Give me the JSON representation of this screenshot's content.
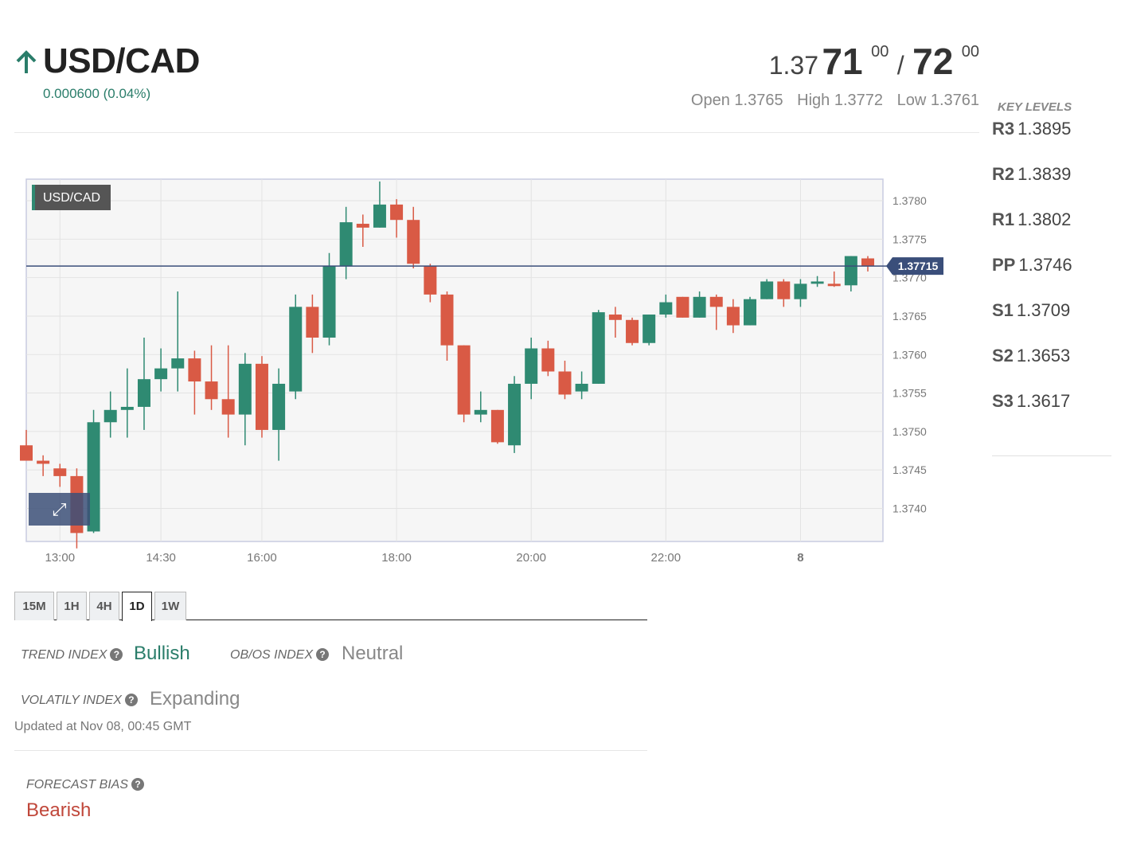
{
  "header": {
    "symbol": "USD/CAD",
    "change": "0.000600 (0.04%)",
    "direction_icon": "arrow-up-icon"
  },
  "quote": {
    "bid_prefix": "1.37",
    "bid_main": "71",
    "bid_sup": "00",
    "separator": "/",
    "ask_main": "72",
    "ask_sup": "00",
    "open": "Open 1.3765",
    "high": "High 1.3772",
    "low": "Low 1.3761"
  },
  "key_levels": {
    "title": "KEY LEVELS",
    "items": [
      {
        "label": "R3",
        "value": "1.3895"
      },
      {
        "label": "R2",
        "value": "1.3839"
      },
      {
        "label": "R1",
        "value": "1.3802"
      },
      {
        "label": "PP",
        "value": "1.3746"
      },
      {
        "label": "S1",
        "value": "1.3709"
      },
      {
        "label": "S2",
        "value": "1.3653"
      },
      {
        "label": "S3",
        "value": "1.3617"
      }
    ]
  },
  "chart_data": {
    "type": "candlestick",
    "symbol_label": "USD/CAD",
    "last_price": 1.37715,
    "last_price_label": "1.37715",
    "ylim": [
      1.37357,
      1.37828
    ],
    "y_ticks": [
      1.374,
      1.3745,
      1.375,
      1.3755,
      1.376,
      1.3765,
      1.377,
      1.3775,
      1.378
    ],
    "y_tick_labels": [
      "1.3740",
      "1.3745",
      "1.3750",
      "1.3755",
      "1.3760",
      "1.3765",
      "1.3770",
      "1.3775",
      "1.3780"
    ],
    "x_ticks": [
      {
        "t": 13.0,
        "label": "13:00"
      },
      {
        "t": 14.5,
        "label": "14:30"
      },
      {
        "t": 16.0,
        "label": "16:00"
      },
      {
        "t": 18.0,
        "label": "18:00"
      },
      {
        "t": 20.0,
        "label": "20:00"
      },
      {
        "t": 22.0,
        "label": "22:00"
      },
      {
        "t": 24.0,
        "label": "8"
      }
    ],
    "grid": true,
    "bull_color": "#2f8a72",
    "bear_color": "#d95a45",
    "candles": [
      {
        "t": 12.5,
        "o": 1.37482,
        "h": 1.37502,
        "l": 1.37472,
        "c": 1.37462
      },
      {
        "t": 12.75,
        "o": 1.37462,
        "h": 1.37469,
        "l": 1.37442,
        "c": 1.37458
      },
      {
        "t": 13.0,
        "o": 1.37452,
        "h": 1.37458,
        "l": 1.37428,
        "c": 1.37442
      },
      {
        "t": 13.25,
        "o": 1.37442,
        "h": 1.37452,
        "l": 1.37348,
        "c": 1.37368
      },
      {
        "t": 13.5,
        "o": 1.3737,
        "h": 1.37528,
        "l": 1.37368,
        "c": 1.37512
      },
      {
        "t": 13.75,
        "o": 1.37512,
        "h": 1.37552,
        "l": 1.37492,
        "c": 1.37528
      },
      {
        "t": 14.0,
        "o": 1.37528,
        "h": 1.37582,
        "l": 1.37492,
        "c": 1.37532
      },
      {
        "t": 14.25,
        "o": 1.37532,
        "h": 1.37622,
        "l": 1.37502,
        "c": 1.37568
      },
      {
        "t": 14.5,
        "o": 1.37568,
        "h": 1.37608,
        "l": 1.37552,
        "c": 1.37582
      },
      {
        "t": 14.75,
        "o": 1.37582,
        "h": 1.37682,
        "l": 1.37552,
        "c": 1.37595
      },
      {
        "t": 15.0,
        "o": 1.37595,
        "h": 1.37605,
        "l": 1.37522,
        "c": 1.37565
      },
      {
        "t": 15.25,
        "o": 1.37565,
        "h": 1.37612,
        "l": 1.37528,
        "c": 1.37542
      },
      {
        "t": 15.5,
        "o": 1.37542,
        "h": 1.37612,
        "l": 1.37492,
        "c": 1.37522
      },
      {
        "t": 15.75,
        "o": 1.37522,
        "h": 1.37602,
        "l": 1.37482,
        "c": 1.37588
      },
      {
        "t": 16.0,
        "o": 1.37588,
        "h": 1.37598,
        "l": 1.37492,
        "c": 1.37502
      },
      {
        "t": 16.25,
        "o": 1.37502,
        "h": 1.37582,
        "l": 1.37462,
        "c": 1.37562
      },
      {
        "t": 16.5,
        "o": 1.37552,
        "h": 1.37678,
        "l": 1.37542,
        "c": 1.37662
      },
      {
        "t": 16.75,
        "o": 1.37662,
        "h": 1.37678,
        "l": 1.37602,
        "c": 1.37622
      },
      {
        "t": 17.0,
        "o": 1.37622,
        "h": 1.37732,
        "l": 1.37612,
        "c": 1.37715
      },
      {
        "t": 17.25,
        "o": 1.37715,
        "h": 1.37792,
        "l": 1.37698,
        "c": 1.37772
      },
      {
        "t": 17.5,
        "o": 1.3777,
        "h": 1.37782,
        "l": 1.3774,
        "c": 1.37765
      },
      {
        "t": 17.75,
        "o": 1.37765,
        "h": 1.37825,
        "l": 1.37765,
        "c": 1.37795
      },
      {
        "t": 18.0,
        "o": 1.37795,
        "h": 1.37802,
        "l": 1.37752,
        "c": 1.37775
      },
      {
        "t": 18.25,
        "o": 1.37775,
        "h": 1.37792,
        "l": 1.37712,
        "c": 1.37718
      },
      {
        "t": 18.5,
        "o": 1.37715,
        "h": 1.37718,
        "l": 1.37668,
        "c": 1.37678
      },
      {
        "t": 18.75,
        "o": 1.37678,
        "h": 1.37682,
        "l": 1.37592,
        "c": 1.37612
      },
      {
        "t": 19.0,
        "o": 1.37612,
        "h": 1.37612,
        "l": 1.37512,
        "c": 1.37522
      },
      {
        "t": 19.25,
        "o": 1.37522,
        "h": 1.37552,
        "l": 1.37512,
        "c": 1.37528
      },
      {
        "t": 19.5,
        "o": 1.37528,
        "h": 1.37528,
        "l": 1.37484,
        "c": 1.37486
      },
      {
        "t": 19.75,
        "o": 1.37482,
        "h": 1.37572,
        "l": 1.37472,
        "c": 1.37562
      },
      {
        "t": 20.0,
        "o": 1.37562,
        "h": 1.37622,
        "l": 1.37542,
        "c": 1.37608
      },
      {
        "t": 20.25,
        "o": 1.37608,
        "h": 1.37618,
        "l": 1.37572,
        "c": 1.37578
      },
      {
        "t": 20.5,
        "o": 1.37578,
        "h": 1.37592,
        "l": 1.37542,
        "c": 1.37548
      },
      {
        "t": 20.75,
        "o": 1.37552,
        "h": 1.37578,
        "l": 1.37542,
        "c": 1.37562
      },
      {
        "t": 21.0,
        "o": 1.37562,
        "h": 1.37658,
        "l": 1.37562,
        "c": 1.37655
      },
      {
        "t": 21.25,
        "o": 1.37652,
        "h": 1.37662,
        "l": 1.37622,
        "c": 1.37645
      },
      {
        "t": 21.5,
        "o": 1.37645,
        "h": 1.37648,
        "l": 1.37612,
        "c": 1.37615
      },
      {
        "t": 21.75,
        "o": 1.37615,
        "h": 1.37652,
        "l": 1.37612,
        "c": 1.37652
      },
      {
        "t": 22.0,
        "o": 1.37652,
        "h": 1.37678,
        "l": 1.37648,
        "c": 1.37668
      },
      {
        "t": 22.25,
        "o": 1.37675,
        "h": 1.37675,
        "l": 1.37648,
        "c": 1.37648
      },
      {
        "t": 22.5,
        "o": 1.37648,
        "h": 1.37682,
        "l": 1.37648,
        "c": 1.37675
      },
      {
        "t": 22.75,
        "o": 1.37675,
        "h": 1.37678,
        "l": 1.37632,
        "c": 1.37662
      },
      {
        "t": 23.0,
        "o": 1.37662,
        "h": 1.37672,
        "l": 1.37628,
        "c": 1.37638
      },
      {
        "t": 23.25,
        "o": 1.37638,
        "h": 1.37675,
        "l": 1.37638,
        "c": 1.37672
      },
      {
        "t": 23.5,
        "o": 1.37672,
        "h": 1.37698,
        "l": 1.37672,
        "c": 1.37695
      },
      {
        "t": 23.75,
        "o": 1.37695,
        "h": 1.37698,
        "l": 1.37662,
        "c": 1.37672
      },
      {
        "t": 24.0,
        "o": 1.37672,
        "h": 1.37698,
        "l": 1.37662,
        "c": 1.37692
      },
      {
        "t": 24.25,
        "o": 1.37692,
        "h": 1.37702,
        "l": 1.37688,
        "c": 1.37695
      },
      {
        "t": 24.5,
        "o": 1.37692,
        "h": 1.37708,
        "l": 1.37688,
        "c": 1.37689
      },
      {
        "t": 24.75,
        "o": 1.3769,
        "h": 1.37728,
        "l": 1.37682,
        "c": 1.37728
      },
      {
        "t": 25.0,
        "o": 1.37725,
        "h": 1.37728,
        "l": 1.37708,
        "c": 1.37715
      }
    ]
  },
  "timeframes": {
    "tabs": [
      "15M",
      "1H",
      "4H",
      "1D",
      "1W"
    ],
    "active": "1D"
  },
  "indices": {
    "trend_label": "TREND INDEX",
    "trend_value": "Bullish",
    "obos_label": "OB/OS INDEX",
    "obos_value": "Neutral",
    "volatility_label": "VOLATILY INDEX",
    "volatility_value": "Expanding",
    "help_icon": "question-circle-icon"
  },
  "updated": "Updated at Nov 08, 00:45 GMT",
  "forecast": {
    "label": "FORECAST BIAS",
    "value": "Bearish"
  },
  "colors": {
    "bullish": "#2a7d6a",
    "bearish": "#c0473a",
    "neutral": "#888888",
    "accent_dark": "#3a4e7a"
  }
}
